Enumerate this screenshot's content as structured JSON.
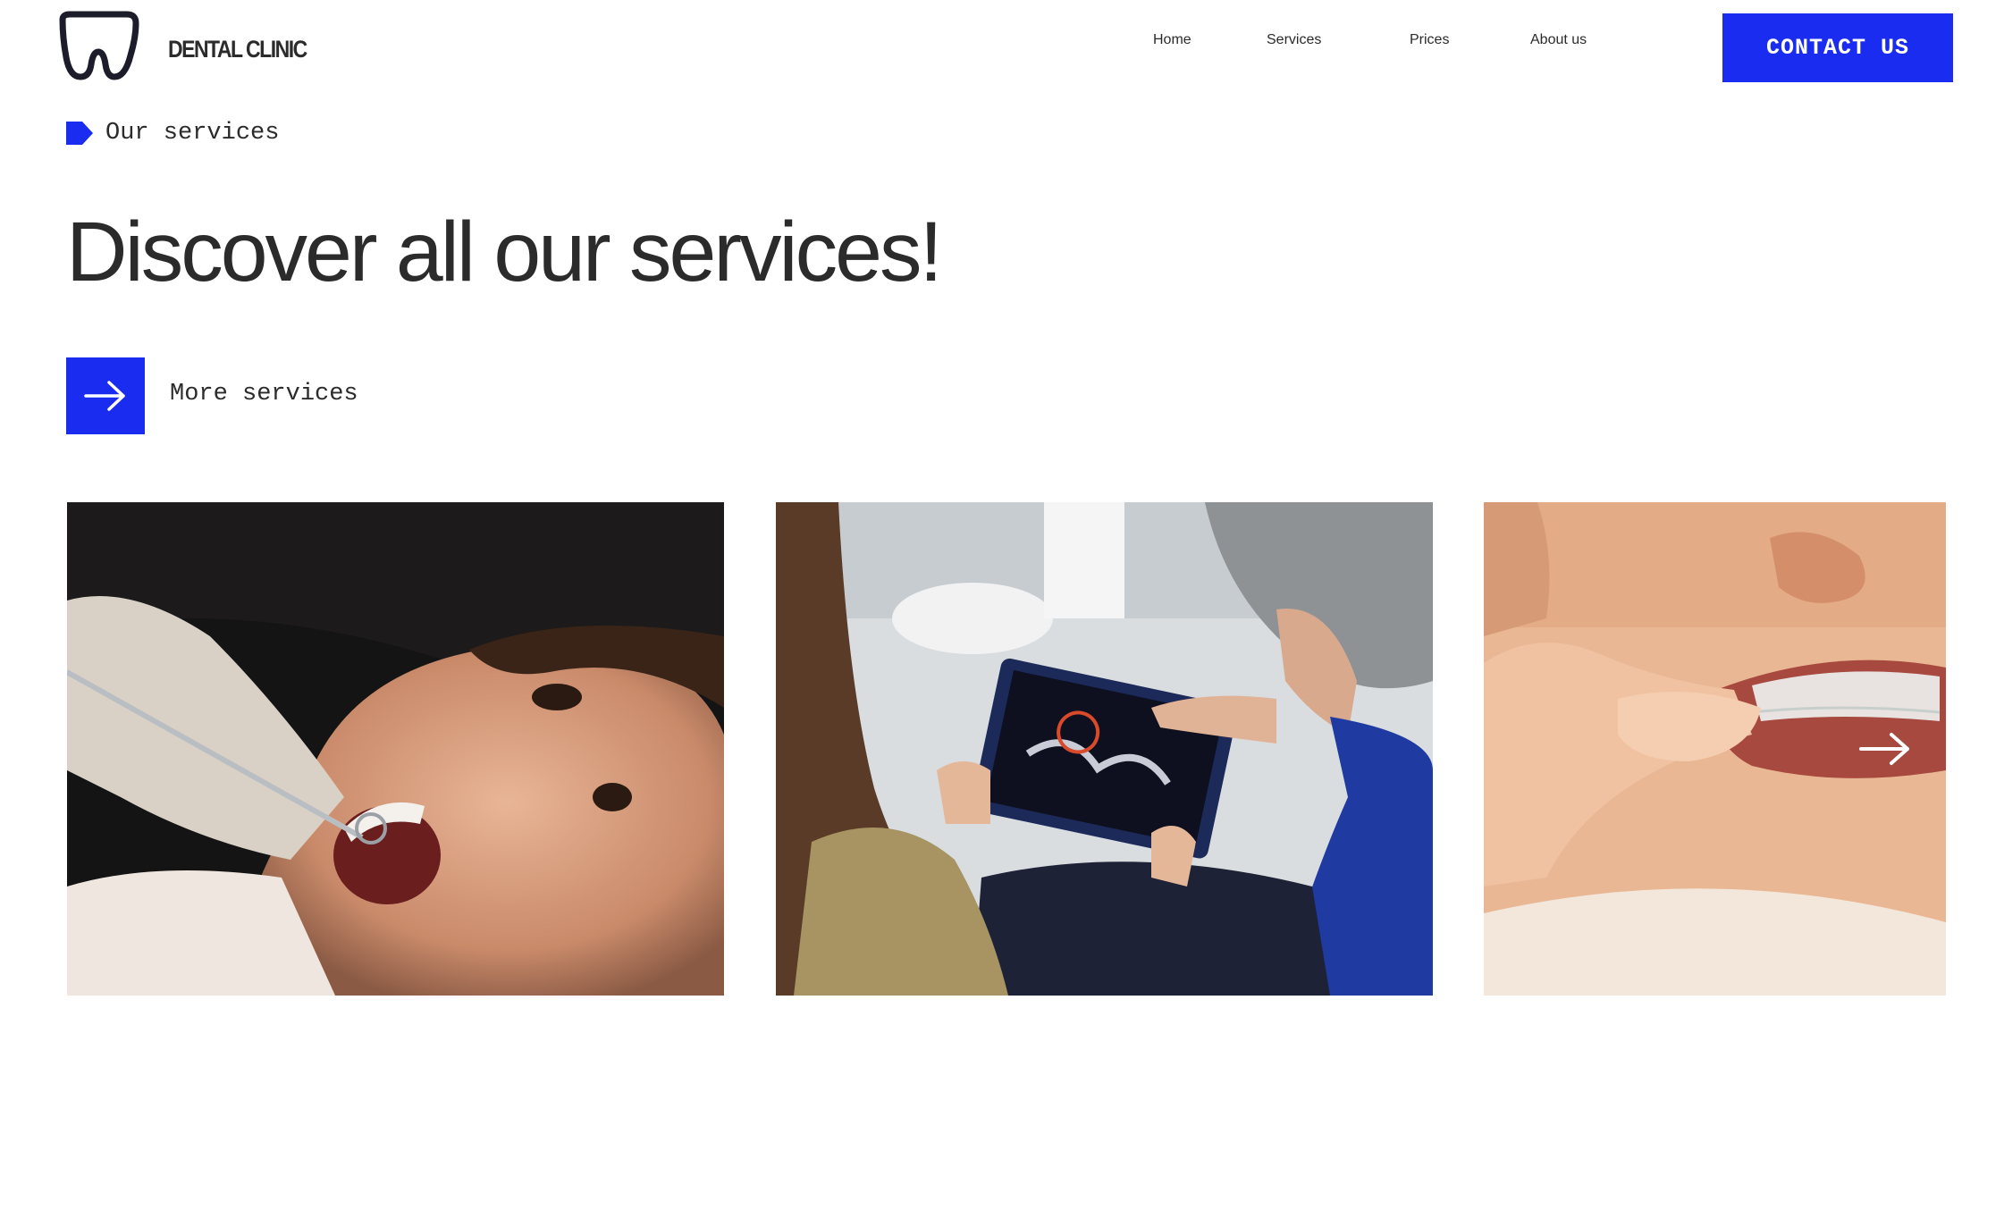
{
  "header": {
    "brand": "DENTAL CLINIC",
    "logo_icon": "tooth-logo-icon",
    "nav": [
      {
        "label": "Home",
        "active": true
      },
      {
        "label": "Services",
        "active": false
      },
      {
        "label": "Prices",
        "active": false
      },
      {
        "label": "About us",
        "active": false
      }
    ],
    "cta_label": "CONTACT US"
  },
  "section": {
    "eyebrow_label": "Our services",
    "eyebrow_icon": "tag-icon",
    "title": "Discover all our services!",
    "more_label": "More services",
    "more_icon": "arrow-right-icon"
  },
  "cards": [
    {
      "image": "dentist-examining-patient-photo"
    },
    {
      "image": "dentist-showing-xray-tablet-photo"
    },
    {
      "image": "clear-aligner-photo"
    }
  ],
  "carousel": {
    "next_icon": "arrow-right-icon"
  },
  "colors": {
    "accent": "#1a2cf0",
    "text": "#2b2b2b",
    "background": "#ffffff"
  }
}
